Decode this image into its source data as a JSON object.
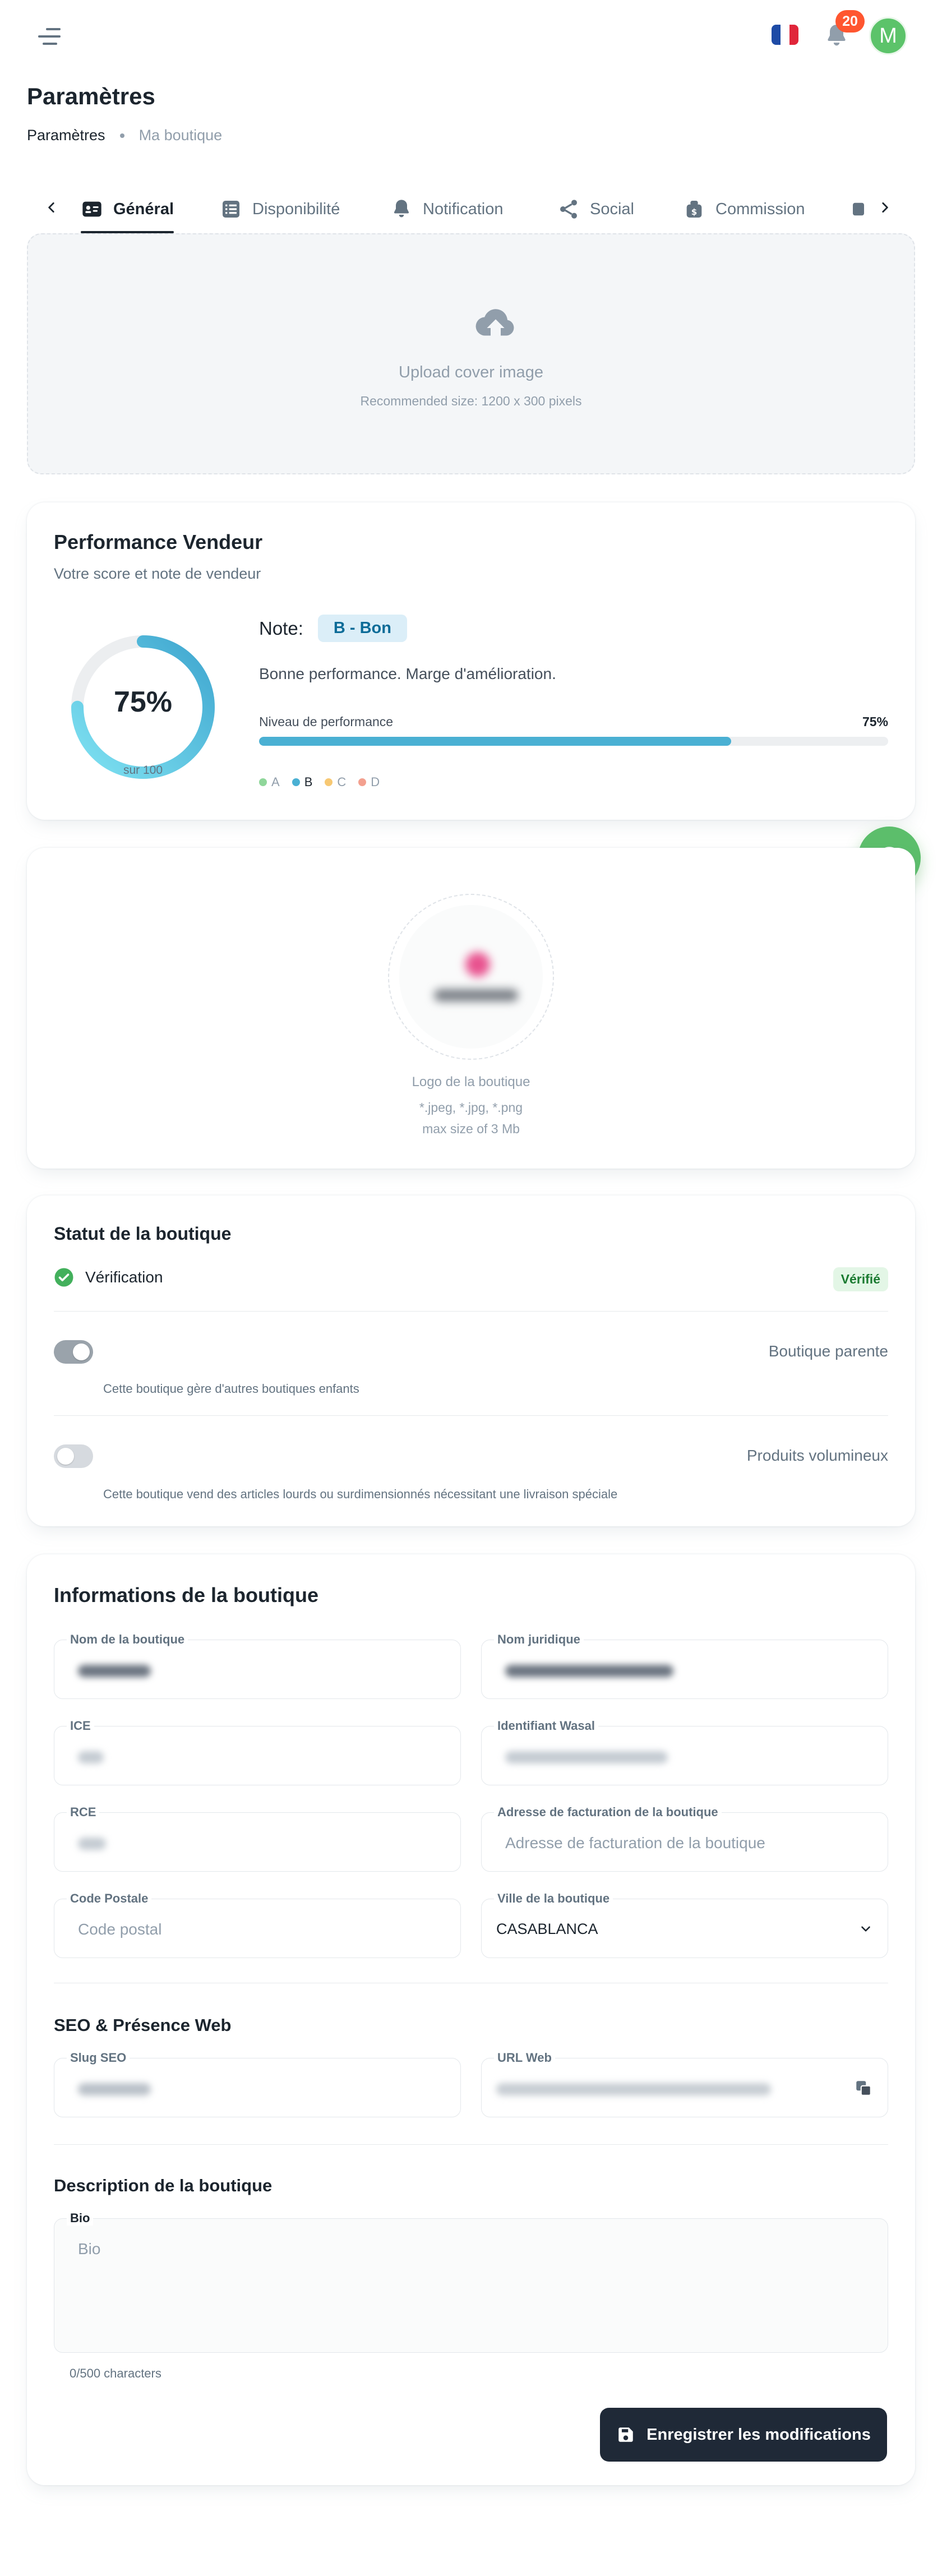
{
  "header": {
    "language_icon": "france-flag-icon",
    "notification_count": "20",
    "avatar_initial": "M",
    "colors": {
      "badge": "#ff5630",
      "avatar": "#5cc36a"
    }
  },
  "page": {
    "title": "Paramètres",
    "breadcrumb": [
      "Paramètres",
      "Ma boutique"
    ]
  },
  "tabs": [
    {
      "label": "Général",
      "icon": "id-card-icon",
      "active": true
    },
    {
      "label": "Disponibilité",
      "icon": "list-icon",
      "active": false
    },
    {
      "label": "Notification",
      "icon": "bell-icon",
      "active": false
    },
    {
      "label": "Social",
      "icon": "share-icon",
      "active": false
    },
    {
      "label": "Commission",
      "icon": "money-bag-icon",
      "active": false
    }
  ],
  "cover": {
    "title": "Upload cover image",
    "hint": "Recommended size: 1200 x 300 pixels"
  },
  "performance": {
    "title": "Performance Vendeur",
    "subtitle": "Votre score et note de vendeur",
    "score_text": "75%",
    "score_sub": "sur 100",
    "score_fraction": 0.75,
    "note_label": "Note:",
    "note_value": "B - Bon",
    "description": "Bonne performance. Marge d'amélioration.",
    "level_label": "Niveau de performance",
    "level_value": "75%",
    "legend": [
      {
        "label": "A",
        "color": "#8fd69a"
      },
      {
        "label": "B",
        "color": "#4ab0d3"
      },
      {
        "label": "C",
        "color": "#f7c873"
      },
      {
        "label": "D",
        "color": "#f3a08f"
      }
    ],
    "accent": "#4ab0d3"
  },
  "logo": {
    "label": "Logo de la boutique",
    "formats": "*.jpeg, *.jpg, *.png",
    "max_size": "max size of 3 Mb"
  },
  "status": {
    "title": "Statut de la boutique",
    "verification_label": "Vérification",
    "verification_badge": "Vérifié",
    "parent": {
      "label": "Boutique parente",
      "help": "Cette boutique gère d'autres boutiques enfants",
      "enabled": true
    },
    "bulky": {
      "label": "Produits volumineux",
      "help": "Cette boutique vend des articles lourds ou surdimensionnés nécessitant une livraison spéciale",
      "enabled": false
    }
  },
  "info": {
    "title": "Informations de la boutique",
    "fields": {
      "shop_name": {
        "label": "Nom de la boutique"
      },
      "legal_name": {
        "label": "Nom juridique"
      },
      "ice": {
        "label": "ICE"
      },
      "wasal_id": {
        "label": "Identifiant Wasal"
      },
      "rce": {
        "label": "RCE"
      },
      "billing_address": {
        "label": "Adresse de facturation de la boutique",
        "placeholder": "Adresse de facturation de la boutique"
      },
      "postal_code": {
        "label": "Code Postale",
        "placeholder": "Code postal"
      },
      "city": {
        "label": "Ville de la boutique",
        "value": "CASABLANCA"
      }
    }
  },
  "seo": {
    "title": "SEO & Présence Web",
    "slug_label": "Slug SEO",
    "url_label": "URL Web"
  },
  "description": {
    "title": "Description de la boutique",
    "bio_label": "Bio",
    "bio_placeholder": "Bio",
    "counter": "0/500 characters"
  },
  "actions": {
    "save_label": "Enregistrer les modifications"
  }
}
